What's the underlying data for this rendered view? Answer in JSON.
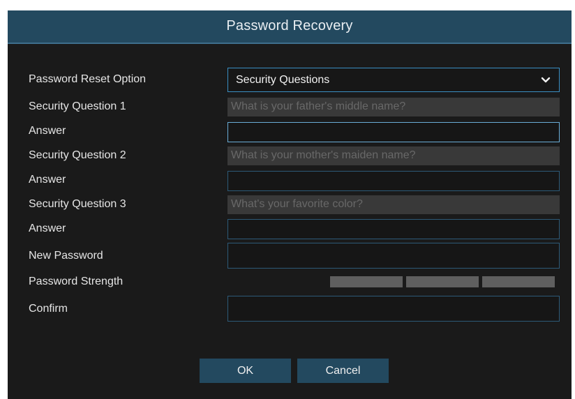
{
  "dialog": {
    "title": "Password Recovery"
  },
  "form": {
    "reset_option_label": "Password Reset Option",
    "reset_option_value": "Security Questions",
    "q1_label": "Security Question 1",
    "q1_value": "What is your father's middle name?",
    "a1_label": "Answer",
    "q2_label": "Security Question 2",
    "q2_value": "What is your mother's maiden name?",
    "a2_label": "Answer",
    "q3_label": "Security Question 3",
    "q3_value": "What's your favorite color?",
    "a3_label": "Answer",
    "new_password_label": "New Password",
    "strength_label": "Password Strength",
    "strength_level": 0,
    "confirm_label": "Confirm"
  },
  "buttons": {
    "ok": "OK",
    "cancel": "Cancel"
  },
  "colors": {
    "titlebar": "#23495f",
    "background": "#1a1a1a",
    "accent_border": "#3a8fc4",
    "question_fill": "#393939",
    "strength_empty": "#5f5f5f"
  }
}
